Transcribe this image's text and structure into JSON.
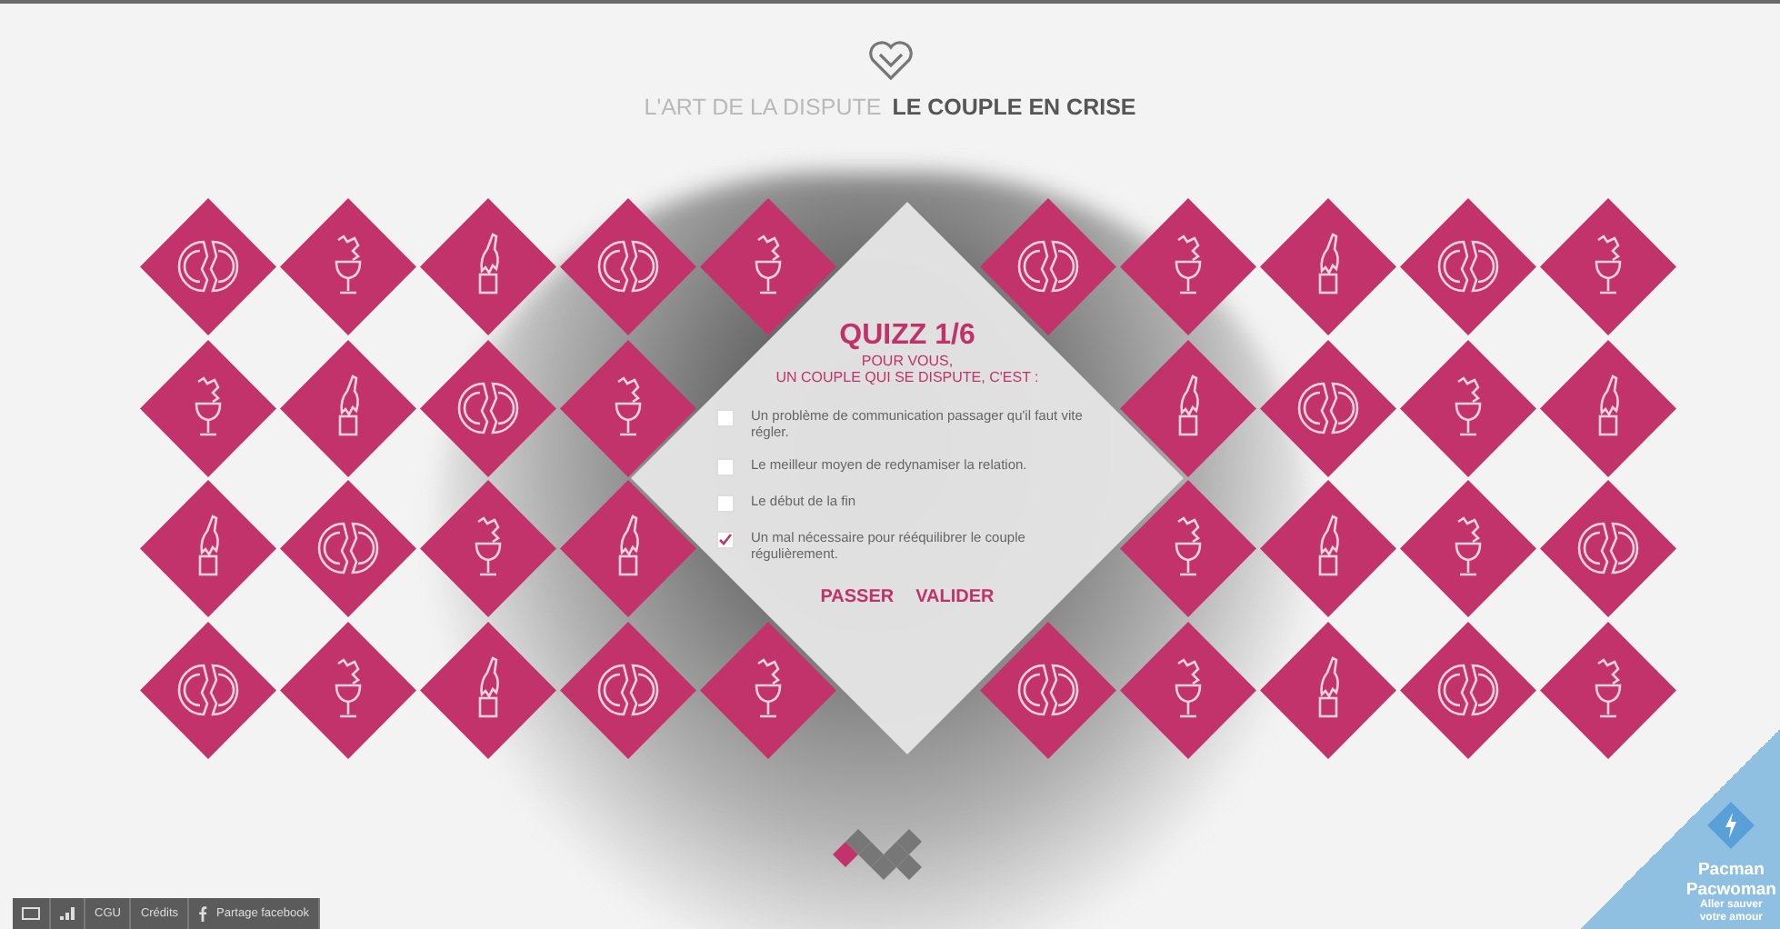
{
  "header": {
    "title_light": "L'ART DE LA DISPUTE",
    "title_bold": "LE COUPLE EN CRISE"
  },
  "tile_rows": [
    {
      "left": [
        {
          "kind": "plate"
        },
        {
          "kind": "glass"
        },
        {
          "kind": "bottle"
        },
        {
          "kind": "plate"
        },
        {
          "kind": "glass"
        }
      ],
      "right": [
        {
          "kind": "plate"
        },
        {
          "kind": "glass"
        },
        {
          "kind": "bottle"
        },
        {
          "kind": "plate"
        },
        {
          "kind": "glass"
        }
      ]
    },
    {
      "left": [
        {
          "kind": "glass"
        },
        {
          "kind": "bottle"
        },
        {
          "kind": "plate"
        },
        {
          "kind": "glass"
        }
      ],
      "right": [
        {
          "kind": "bottle"
        },
        {
          "kind": "plate"
        },
        {
          "kind": "glass"
        },
        {
          "kind": "bottle"
        }
      ]
    },
    {
      "left": [
        {
          "kind": "bottle"
        },
        {
          "kind": "plate"
        },
        {
          "kind": "glass"
        },
        {
          "kind": "bottle"
        }
      ],
      "right": [
        {
          "kind": "glass"
        },
        {
          "kind": "bottle"
        },
        {
          "kind": "glass"
        },
        {
          "kind": "plate"
        }
      ]
    },
    {
      "left": [
        {
          "kind": "plate"
        },
        {
          "kind": "glass"
        },
        {
          "kind": "bottle"
        },
        {
          "kind": "plate"
        },
        {
          "kind": "glass"
        }
      ],
      "right": [
        {
          "kind": "plate"
        },
        {
          "kind": "glass"
        },
        {
          "kind": "bottle"
        },
        {
          "kind": "plate"
        },
        {
          "kind": "glass"
        }
      ]
    }
  ],
  "quiz": {
    "title": "QUIZZ 1/6",
    "subtitle_lines": [
      "POUR VOUS,",
      "UN COUPLE QUI SE DISPUTE, C'EST :"
    ],
    "options": [
      {
        "label": "Un problème de communication passager qu'il faut vite régler.",
        "checked": false
      },
      {
        "label": "Le meilleur moyen de redynamiser la relation.",
        "checked": false
      },
      {
        "label": "Le début de la fin",
        "checked": false
      },
      {
        "label": "Un mal nécessaire pour rééquilibrer le couple régulièrement.",
        "checked": true
      }
    ],
    "buttons": [
      "PASSER",
      "VALIDER"
    ]
  },
  "footer": {
    "links": [
      "CGU",
      "Crédits"
    ],
    "share": "Partage facebook"
  },
  "promo": {
    "title_lines": [
      "Pacman",
      "Pacwoman"
    ],
    "subtitle_lines": [
      "Aller sauver",
      "votre amour"
    ]
  }
}
